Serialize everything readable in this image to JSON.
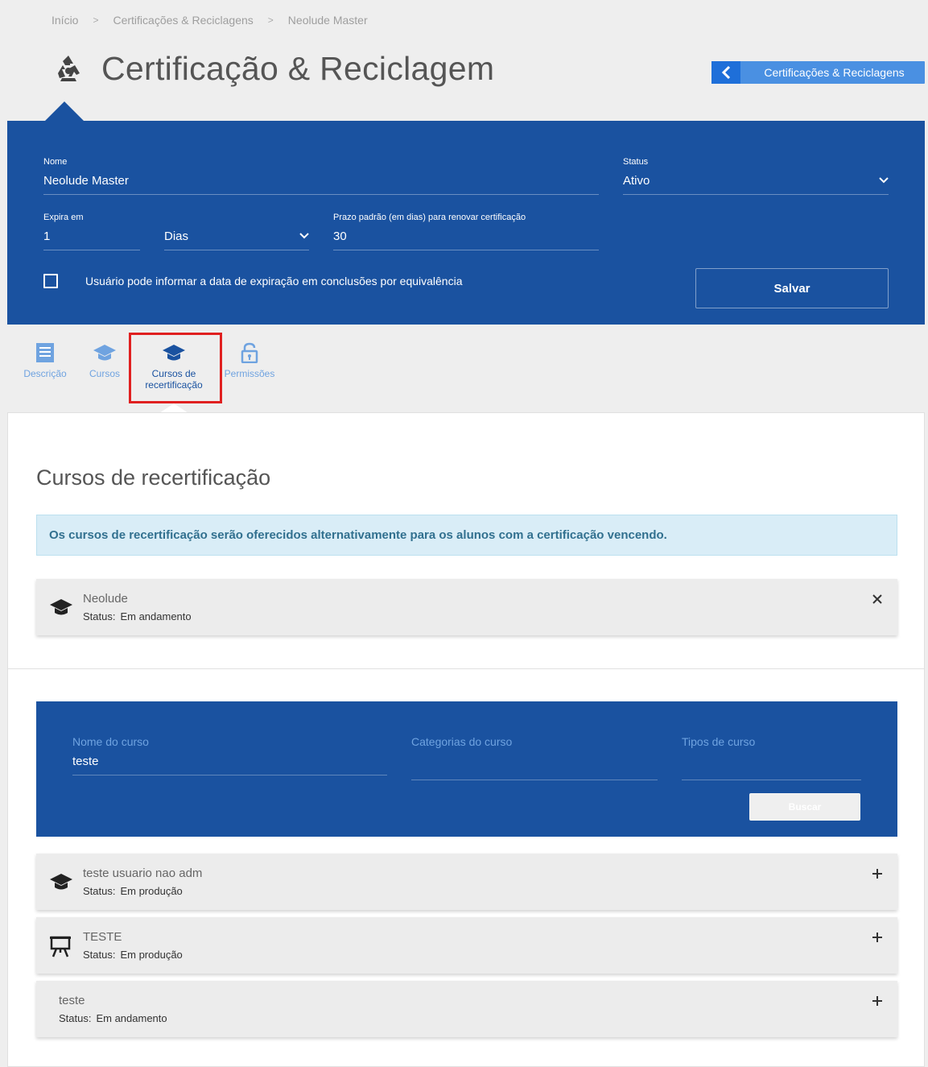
{
  "breadcrumb": {
    "items": [
      "Início",
      "Certificações & Reciclagens",
      "Neolude Master"
    ],
    "separator": ">"
  },
  "header": {
    "title": "Certificação & Reciclagem",
    "icon": "recycle-icon",
    "back_button_label": "Certificações & Reciclagens"
  },
  "form": {
    "name_label": "Nome",
    "name_value": "Neolude Master",
    "status_label": "Status",
    "status_value": "Ativo",
    "expires_label": "Expira em",
    "expires_value": "1",
    "unit_value": "Dias",
    "deadline_label": "Prazo padrão (em dias) para renovar certificação",
    "deadline_value": "30",
    "checkbox_label": "Usuário pode informar a data de expiração em conclusões por equivalência",
    "checkbox_checked": false,
    "save_label": "Salvar"
  },
  "tabs": [
    {
      "label": "Descrição",
      "icon": "document-icon",
      "active": false
    },
    {
      "label": "Cursos",
      "icon": "graduation-cap-icon",
      "active": false
    },
    {
      "label_line1": "Cursos de",
      "label_line2": "recertificação",
      "icon": "graduation-cap-icon",
      "active": true
    },
    {
      "label": "Permissões",
      "icon": "lock-icon",
      "active": false
    }
  ],
  "content": {
    "title": "Cursos de recertificação",
    "info": "Os cursos de recertificação serão oferecidos alternativamente para os alunos com a certificação vencendo.",
    "selected_courses": [
      {
        "name": "Neolude",
        "status_label": "Status:",
        "status": "Em andamento",
        "icon": "graduation-cap-icon"
      }
    ]
  },
  "search": {
    "course_name_label": "Nome do curso",
    "course_name_value": "teste",
    "categories_label": "Categorias do curso",
    "categories_value": "",
    "types_label": "Tipos de curso",
    "types_value": "",
    "button_label": "Buscar"
  },
  "results": [
    {
      "name": "teste usuario nao adm",
      "status_label": "Status:",
      "status": "Em produção",
      "icon": "graduation-cap-icon"
    },
    {
      "name": "TESTE",
      "status_label": "Status:",
      "status": "Em produção",
      "icon": "presentation-easel-icon"
    },
    {
      "name": "teste",
      "status_label": "Status:",
      "status": "Em andamento",
      "icon": ""
    }
  ],
  "colors": {
    "primary": "#1a52a0",
    "accent": "#4a90e2",
    "info_bg": "#d9edf7",
    "info_text": "#31708f",
    "highlight": "#e02020"
  }
}
